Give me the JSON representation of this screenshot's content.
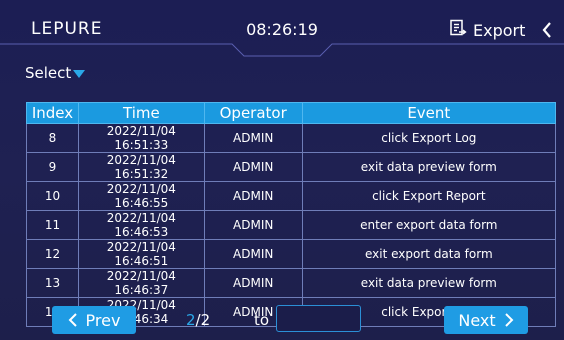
{
  "header": {
    "logo": "LEPURE",
    "time": "08:26:19",
    "export_label": "Export"
  },
  "select": {
    "label": "Select"
  },
  "table": {
    "columns": [
      "Index",
      "Time",
      "Operator",
      "Event"
    ],
    "rows": [
      {
        "index": "8",
        "time": "2022/11/04 16:51:33",
        "operator": "ADMIN",
        "event": "click Export Log"
      },
      {
        "index": "9",
        "time": "2022/11/04 16:51:32",
        "operator": "ADMIN",
        "event": "exit data preview form"
      },
      {
        "index": "10",
        "time": "2022/11/04 16:46:55",
        "operator": "ADMIN",
        "event": "click Export Report"
      },
      {
        "index": "11",
        "time": "2022/11/04 16:46:53",
        "operator": "ADMIN",
        "event": "enter export data form"
      },
      {
        "index": "12",
        "time": "2022/11/04 16:46:51",
        "operator": "ADMIN",
        "event": "exit export data form"
      },
      {
        "index": "13",
        "time": "2022/11/04 16:46:37",
        "operator": "ADMIN",
        "event": "exit data preview form"
      },
      {
        "index": "14",
        "time": "2022/11/04 16:46:34",
        "operator": "ADMIN",
        "event": "click Export Log"
      }
    ]
  },
  "pager": {
    "prev_label": "Prev",
    "next_label": "Next",
    "current_page": "2",
    "total_pages": "/2",
    "to_label": "to",
    "goto_value": ""
  },
  "colors": {
    "background": "#1d1f4f",
    "accent": "#1f9ce4",
    "header_row": "#1b9ae0"
  },
  "icons": {
    "export": "export-document-icon",
    "back": "chevron-left-icon",
    "dropdown": "triangle-down-icon"
  }
}
